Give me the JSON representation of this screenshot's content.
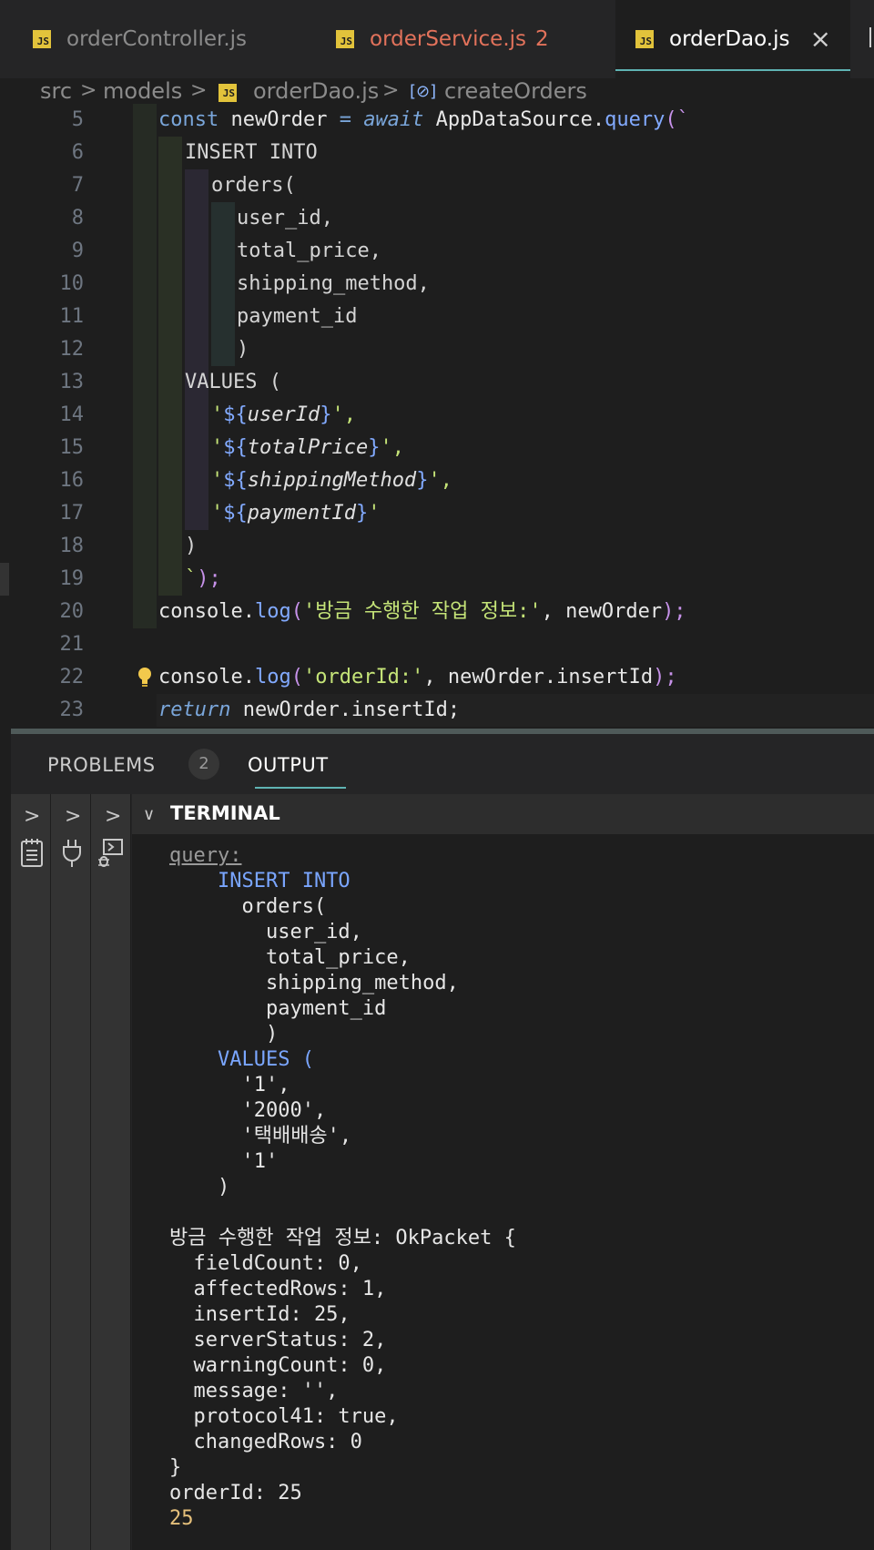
{
  "tabs": [
    {
      "label": "orderController.js",
      "file_type": "JS"
    },
    {
      "label": "orderService.js",
      "file_type": "JS",
      "problems": "2"
    },
    {
      "label": "orderDao.js",
      "file_type": "JS",
      "close": "×"
    }
  ],
  "breadcrumb": {
    "parts": [
      "src",
      "models",
      "orderDao.js",
      "createOrders"
    ],
    "separator": ">",
    "file_icon": "JS",
    "symbol_icon": "[⊘]"
  },
  "editor": {
    "lines": [
      {
        "n": "5"
      },
      {
        "n": "6"
      },
      {
        "n": "7"
      },
      {
        "n": "8"
      },
      {
        "n": "9"
      },
      {
        "n": "10"
      },
      {
        "n": "11"
      },
      {
        "n": "12"
      },
      {
        "n": "13"
      },
      {
        "n": "14"
      },
      {
        "n": "15"
      },
      {
        "n": "16"
      },
      {
        "n": "17"
      },
      {
        "n": "18"
      },
      {
        "n": "19"
      },
      {
        "n": "20"
      },
      {
        "n": "21"
      },
      {
        "n": "22"
      },
      {
        "n": "23"
      }
    ],
    "code": {
      "l5": [
        "const",
        " newOrder ",
        "=",
        " ",
        "await",
        " AppDataSource.",
        "query",
        "(`"
      ],
      "l6": "INSERT INTO",
      "l7": "orders(",
      "l8": "user_id,",
      "l9": "total_price,",
      "l10": "shipping_method,",
      "l11": "payment_id",
      "l12": ")",
      "l13": "VALUES (",
      "l14": [
        "'",
        "${",
        "userId",
        "}",
        "',"
      ],
      "l15": [
        "'",
        "${",
        "totalPrice",
        "}",
        "',"
      ],
      "l16": [
        "'",
        "${",
        "shippingMethod",
        "}",
        "',"
      ],
      "l17": [
        "'",
        "${",
        "paymentId",
        "}",
        "'"
      ],
      "l18": ")",
      "l19": [
        "`",
        ");"
      ],
      "l20": [
        "console.",
        "log",
        "(",
        "'방금 수행한 작업 정보:'",
        ", newOrder",
        ");"
      ],
      "l22": [
        "console.",
        "log",
        "(",
        "'orderId:'",
        ", newOrder.insertId",
        ");"
      ],
      "l23": [
        "return",
        " newOrder.insertId;"
      ]
    }
  },
  "panel": {
    "tabs": [
      {
        "label": "PROBLEMS",
        "badge": "2"
      },
      {
        "label": "OUTPUT"
      }
    ],
    "terminal_title": "TERMINAL",
    "chevron": ">",
    "terminal_lines": [
      "query:",
      "    INSERT INTO",
      "      orders(",
      "        user_id,",
      "        total_price,",
      "        shipping_method,",
      "        payment_id",
      "        )",
      "    VALUES (",
      "      '1',",
      "      '2000',",
      "      '택배배송',",
      "      '1'",
      "    )",
      "",
      "방금 수행한 작업 정보: OkPacket {",
      "  fieldCount: 0,",
      "  affectedRows: 1,",
      "  insertId: 25,",
      "  serverStatus: 2,",
      "  warningCount: 0,",
      "  message: '',",
      "  protocol41: true,",
      "  changedRows: 0",
      "}",
      "orderId: 25",
      "25"
    ]
  },
  "colors": {
    "js_icon": "#e2c33b",
    "modified_tab": "#e2725b",
    "active_underline": "#5fb3b3",
    "keyword": "#7aa6da",
    "string": "#c5e478",
    "number": "#e5c07b"
  },
  "icons": [
    "js-file-icon",
    "close-icon",
    "symbol-method-icon",
    "lightbulb-icon",
    "chevron-right-icon",
    "chevron-down-icon",
    "notebook-icon",
    "plug-icon",
    "debug-console-icon"
  ]
}
